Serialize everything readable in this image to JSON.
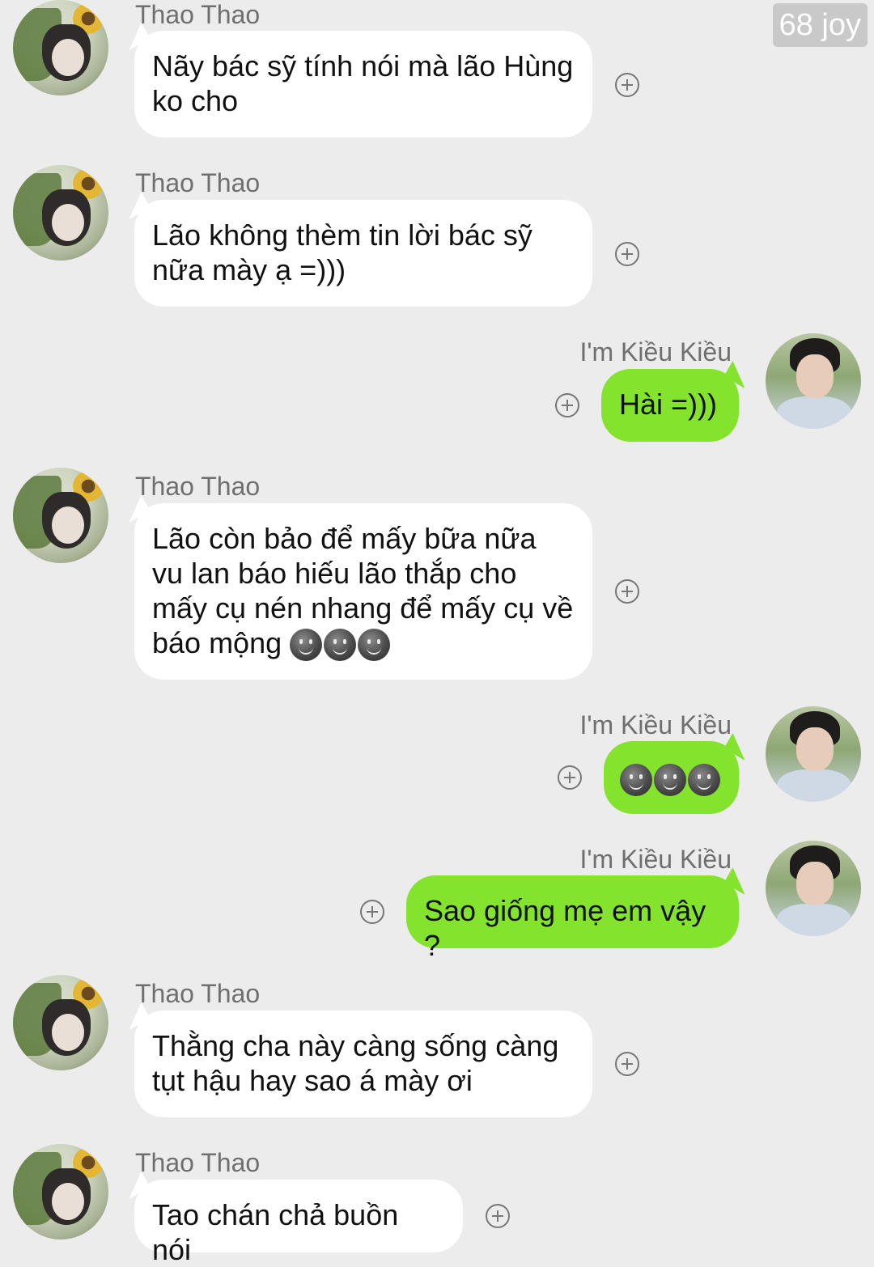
{
  "watermark": "68 joy",
  "messages": [
    {
      "sender": "Thao Thao",
      "text": "Nãy bác sỹ tính nói mà lão Hùng ko cho"
    },
    {
      "sender": "Thao Thao",
      "text": "Lão không thèm tin lời bác sỹ nữa mày ạ =)))"
    },
    {
      "sender": "I'm Kiều Kiều",
      "text": "Hài =)))"
    },
    {
      "sender": "Thao Thao",
      "text": "Lão còn bảo để mấy bữa nữa vu lan báo hiếu lão thắp cho mấy cụ nén nhang để mấy cụ về báo mộng",
      "emoji": "new-moon-face ×3"
    },
    {
      "sender": "I'm Kiều Kiều",
      "text": "",
      "emoji": "new-moon-face ×3"
    },
    {
      "sender": "I'm Kiều Kiều",
      "text": "Sao giống mẹ em vậy ?"
    },
    {
      "sender": "Thao Thao",
      "text": "Thằng cha này càng sống càng tụt hậu hay sao á mày ơi"
    },
    {
      "sender": "Thao Thao",
      "text": "Tao chán chả buồn nói"
    }
  ],
  "colors": {
    "background": "#ececec",
    "incoming_bubble": "#ffffff",
    "outgoing_bubble": "#84e32c"
  }
}
